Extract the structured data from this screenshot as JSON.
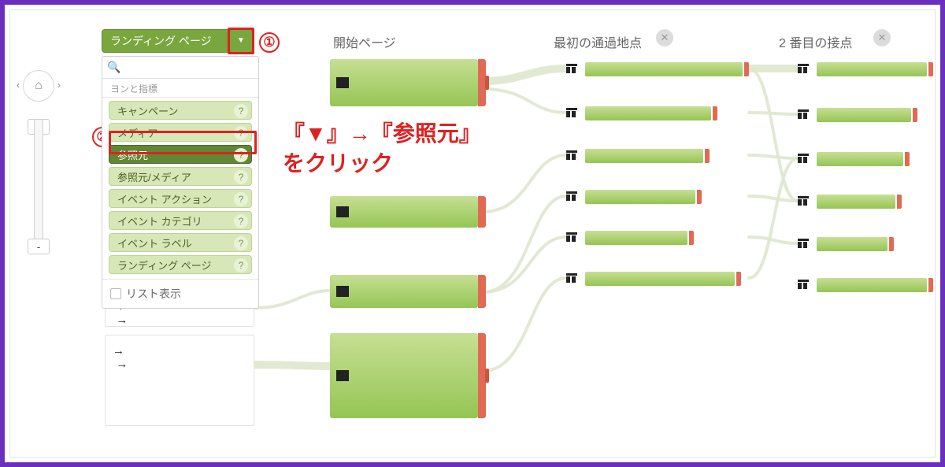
{
  "picker": {
    "current": "ランディング ページ",
    "group_label": "ヨンと指標",
    "search_placeholder": "",
    "items": [
      "キャンペーン",
      "メディア",
      "参照元",
      "参照元/メディア",
      "イベント アクション",
      "イベント カテゴリ",
      "イベント ラベル",
      "ランディング ページ"
    ],
    "selected_index": 2,
    "list_toggle": "リスト表示"
  },
  "columns": {
    "c1": "開始ページ",
    "c2": "最初の通過地点",
    "c3": "2 番目の接点"
  },
  "annot": {
    "n1": "①",
    "n2": "②",
    "line1": "『▼』→『参照元』",
    "line2": "をクリック"
  }
}
